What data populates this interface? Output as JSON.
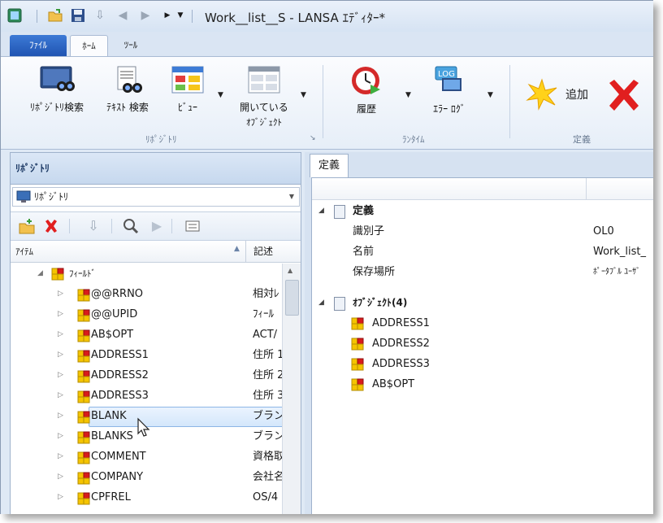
{
  "window": {
    "title": "Work__list__S - LANSA ｴﾃﾞｨﾀｰ*"
  },
  "ribbon": {
    "tabs": [
      "ﾌｧｲﾙ",
      "ﾎｰﾑ",
      "ﾂｰﾙ"
    ],
    "buttons": {
      "repo_search": "ﾘﾎﾟｼﾞﾄﾘ検索",
      "text_search": "ﾃｷｽﾄ 検索",
      "view": "ﾋﾞｭｰ",
      "open_objects_1": "開いている",
      "open_objects_2": "ｵﾌﾞｼﾞｪｸﾄ",
      "history": "履歴",
      "error_log": "ｴﾗｰ ﾛｸﾞ",
      "add": "追加"
    },
    "groups": {
      "repository": "ﾘﾎﾟｼﾞﾄﾘ",
      "runtime": "ﾗﾝﾀｲﾑ",
      "definition": "定義"
    },
    "log_badge": "LOG"
  },
  "left_panel": {
    "header": "ﾘﾎﾟｼﾞﾄﾘ",
    "combo_value": "ﾘﾎﾟｼﾞﾄﾘ",
    "columns": {
      "item": "ｱｲﾃﾑ",
      "desc": "記述"
    },
    "root": "ﾌｨｰﾙﾄﾞ",
    "rows": [
      {
        "name": "@@RRNO",
        "desc": "相対ﾚ"
      },
      {
        "name": "@@UPID",
        "desc": "ﾌｨｰﾙ"
      },
      {
        "name": "AB$OPT",
        "desc": "ACT/"
      },
      {
        "name": "ADDRESS1",
        "desc": "住所 1"
      },
      {
        "name": "ADDRESS2",
        "desc": "住所 2"
      },
      {
        "name": "ADDRESS3",
        "desc": "住所 3"
      },
      {
        "name": "BLANK",
        "desc": "ブラン"
      },
      {
        "name": "BLANKS",
        "desc": "ブラン"
      },
      {
        "name": "COMMENT",
        "desc": "資格取"
      },
      {
        "name": "COMPANY",
        "desc": "会社名"
      },
      {
        "name": "CPFREL",
        "desc": "OS/4"
      }
    ]
  },
  "right_panel": {
    "tab": "定義",
    "section_definition": "定義",
    "properties": [
      {
        "key": "識別子",
        "value": "OL0"
      },
      {
        "key": "名前",
        "value": "Work_list_"
      },
      {
        "key": "保存場所",
        "value": "ﾎﾟｰﾀﾌﾞﾙ ﾕｰｻﾞ"
      }
    ],
    "section_objects": "ｵﾌﾞｼﾞｪｸﾄ(4)",
    "objects": [
      "ADDRESS1",
      "ADDRESS2",
      "ADDRESS3",
      "AB$OPT"
    ]
  },
  "colors": {
    "field_icon_yellow": "#f5c400",
    "field_icon_red": "#d81b1b",
    "accent_blue": "#1f54b2"
  }
}
